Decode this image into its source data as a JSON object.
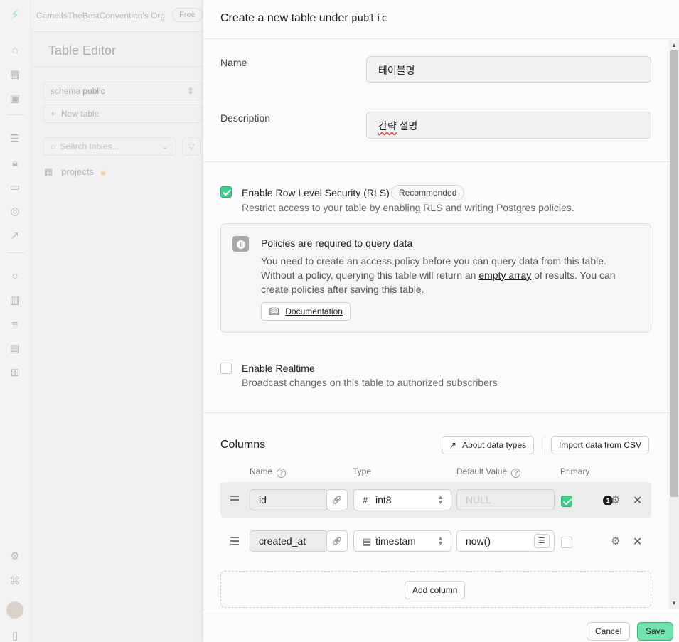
{
  "app": {
    "org_name": "CamelIsTheBestConvention's Org",
    "plan_badge": "Free",
    "panel_title": "Table Editor",
    "schema_label": "schema",
    "schema_value": "public",
    "new_table_label": "New table",
    "search_placeholder": "Search tables...",
    "tables": [
      {
        "name": "projects",
        "icon": "lock-icon"
      }
    ]
  },
  "sheet": {
    "title_prefix": "Create a new table under",
    "schema": "public",
    "name_label": "Name",
    "name_value": "테이블명",
    "description_label": "Description",
    "description_value_word1": "간략",
    "description_value_word2": "설명",
    "rls": {
      "checked": true,
      "label": "Enable Row Level Security (RLS)",
      "badge": "Recommended",
      "help": "Restrict access to your table by enabling RLS and writing Postgres policies."
    },
    "alert": {
      "title": "Policies are required to query data",
      "body_pre": "You need to create an access policy before you can query data from this table. Without a policy, querying this table will return an ",
      "body_link": "empty array",
      "body_post": " of results. You can create policies after saving this table.",
      "doc_button": "Documentation"
    },
    "realtime": {
      "checked": false,
      "label": "Enable Realtime",
      "help": "Broadcast changes on this table to authorized subscribers"
    },
    "columns": {
      "title": "Columns",
      "about_button": "About data types",
      "import_button": "Import data from CSV",
      "headers": {
        "name": "Name",
        "type": "Type",
        "default": "Default Value",
        "primary": "Primary"
      },
      "rows": [
        {
          "name": "id",
          "type": "int8",
          "type_icon": "hash-icon",
          "default": "",
          "default_placeholder": "NULL",
          "primary": true,
          "badge": "1"
        },
        {
          "name": "created_at",
          "type": "timestam",
          "type_icon": "calendar-icon",
          "default": "now()",
          "default_placeholder": "",
          "primary": false,
          "badge": ""
        }
      ],
      "add_button": "Add column"
    },
    "footer": {
      "cancel": "Cancel",
      "save": "Save"
    }
  },
  "colors": {
    "accent": "#3ecf8e",
    "save_bg": "#72e3ad"
  }
}
